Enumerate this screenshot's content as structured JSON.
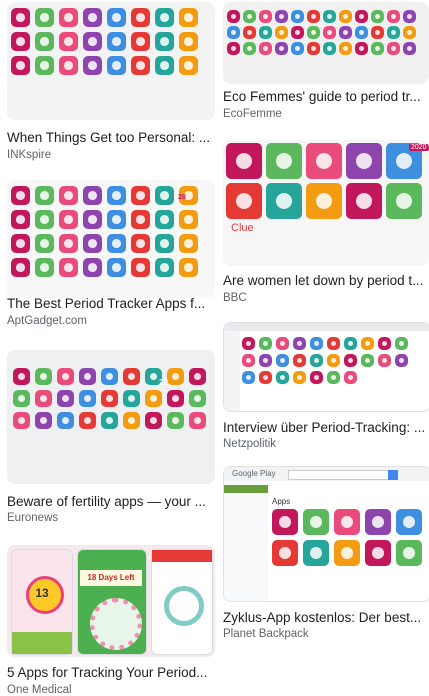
{
  "results": [
    {
      "title": "When Things Get too Personal: ...",
      "source": "INKspire"
    },
    {
      "title": "Eco Femmes' guide to period tr...",
      "source": "EcoFemme"
    },
    {
      "title": "The Best Period Tracker Apps f...",
      "source": "AptGadget.com"
    },
    {
      "title": "Are women let down by period t...",
      "source": "BBC"
    },
    {
      "title": "Interview über Period-Tracking: ...",
      "source": "Netzpolitik"
    },
    {
      "title": "Beware of fertility apps — your ...",
      "source": "Euronews"
    },
    {
      "title": "Zyklus-App kostenlos: Der best...",
      "source": "Planet Backpack"
    },
    {
      "title": "5 Apps for Tracking Your Period...",
      "source": "One Medical"
    }
  ],
  "thumb_text": {
    "bbc_clue": "Clue",
    "bbc_badge": "2020",
    "apt_badge": "28",
    "euro_badge": "28",
    "planet_store": "Google Play",
    "planet_apps": "Apps",
    "onemed_days": "18 Days Left",
    "onemed_num": "13"
  },
  "colors": {
    "pink": "#e94b7b",
    "red": "#e53935",
    "magenta": "#c2185b",
    "purple": "#8e44ad",
    "teal": "#26a69a",
    "green": "#5cb85c",
    "blue": "#3f8fe0",
    "orange": "#f39c12"
  }
}
